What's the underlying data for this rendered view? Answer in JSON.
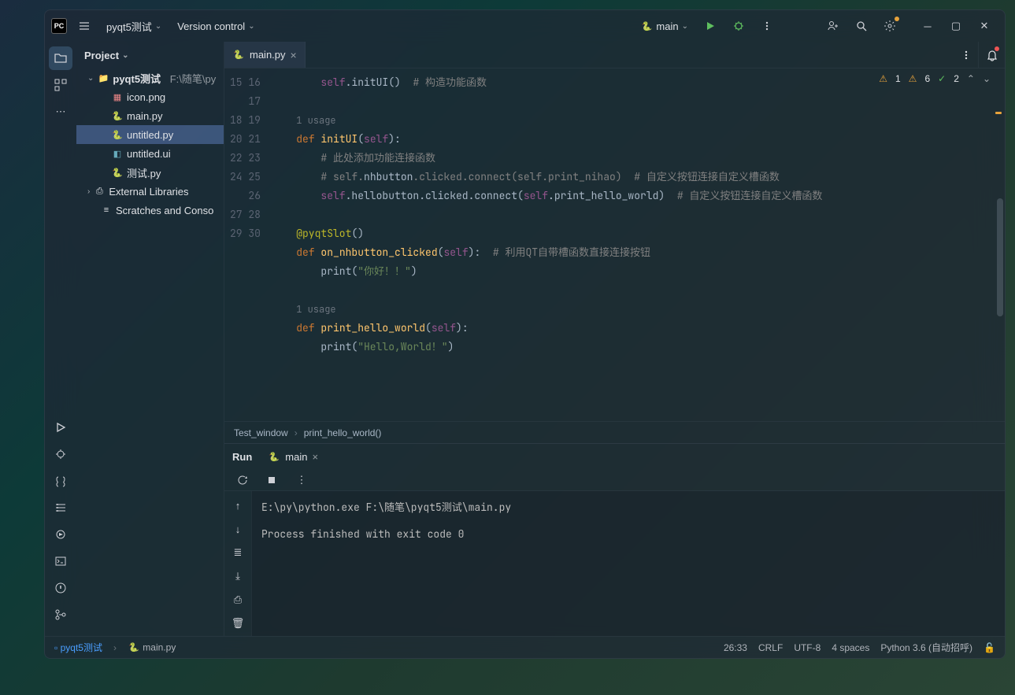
{
  "titlebar": {
    "project_name": "pyqt5测试",
    "version_control": "Version control",
    "run_config": "main"
  },
  "project_panel": {
    "header": "Project",
    "root": "pyqt5测试",
    "root_path": "F:\\随笔\\py",
    "files": [
      {
        "name": "icon.png",
        "type": "img"
      },
      {
        "name": "main.py",
        "type": "py"
      },
      {
        "name": "untitled.py",
        "type": "py",
        "selected": true
      },
      {
        "name": "untitled.ui",
        "type": "ui"
      },
      {
        "name": "测试.py",
        "type": "py"
      }
    ],
    "external": "External Libraries",
    "scratches": "Scratches and Conso"
  },
  "tabs": {
    "active": "main.py"
  },
  "inspections": {
    "warn1": "1",
    "warn2": "6",
    "ok": "2"
  },
  "code_lines": [
    {
      "n": 15,
      "html": "        <span class='self'>self</span>.initUI<span class='id'>()</span>  <span class='cm'># 构造功能函数</span>"
    },
    {
      "n": 16,
      "html": ""
    },
    {
      "n": "",
      "html": "    <span class='hint'>1 usage</span>"
    },
    {
      "n": 17,
      "html": "    <span class='kw'>def</span> <span class='fn'>initUI</span>(<span class='self'>self</span>):"
    },
    {
      "n": 18,
      "html": "        <span class='cm'># 此处添加功能连接函数</span>"
    },
    {
      "n": 19,
      "html": "        <span class='cm'># self.</span><span class='id'>nhbutton</span><span class='cm'>.clicked.connect(self.print_nihao)  # 自定义按钮连接自定义槽函数</span>"
    },
    {
      "n": 20,
      "html": "        <span class='self'>self</span>.hellobutton.clicked.connect(<span class='self'>self</span>.print_hello_world)  <span class='cm'># 自定义按钮连接自定义槽函数</span>"
    },
    {
      "n": 21,
      "html": ""
    },
    {
      "n": 22,
      "html": "    <span class='dec'>@pyqtSlot</span>()"
    },
    {
      "n": 23,
      "html": "    <span class='kw'>def</span> <span class='fn'>on_nhbutton_clicked</span>(<span class='self'>self</span>):  <span class='cm'># 利用QT自带槽函数直接连接按钮</span>"
    },
    {
      "n": 24,
      "html": "        print(<span class='str'>\"你好！！\"</span>)"
    },
    {
      "n": 25,
      "html": ""
    },
    {
      "n": "",
      "html": "    <span class='hint'>1 usage</span>"
    },
    {
      "n": 26,
      "html": "    <span class='kw'>def</span> <span class='fn'>print_hello_world</span>(<span class='self'>self</span>):"
    },
    {
      "n": 27,
      "html": "        print(<span class='str'>\"Hello,World！\"</span>)"
    },
    {
      "n": 28,
      "html": ""
    },
    {
      "n": 29,
      "html": ""
    },
    {
      "n": 30,
      "html": ""
    }
  ],
  "breadcrumb": {
    "cls": "Test_window",
    "fn": "print_hello_world()"
  },
  "run": {
    "label": "Run",
    "tab": "main",
    "output": "E:\\py\\python.exe F:\\随笔\\pyqt5测试\\main.py\n\nProcess finished with exit code 0"
  },
  "statusbar": {
    "crumb_project": "pyqt5测试",
    "crumb_file": "main.py",
    "pos": "26:33",
    "eol": "CRLF",
    "enc": "UTF-8",
    "indent": "4 spaces",
    "interpreter": "Python 3.6 (自动招呼)"
  }
}
